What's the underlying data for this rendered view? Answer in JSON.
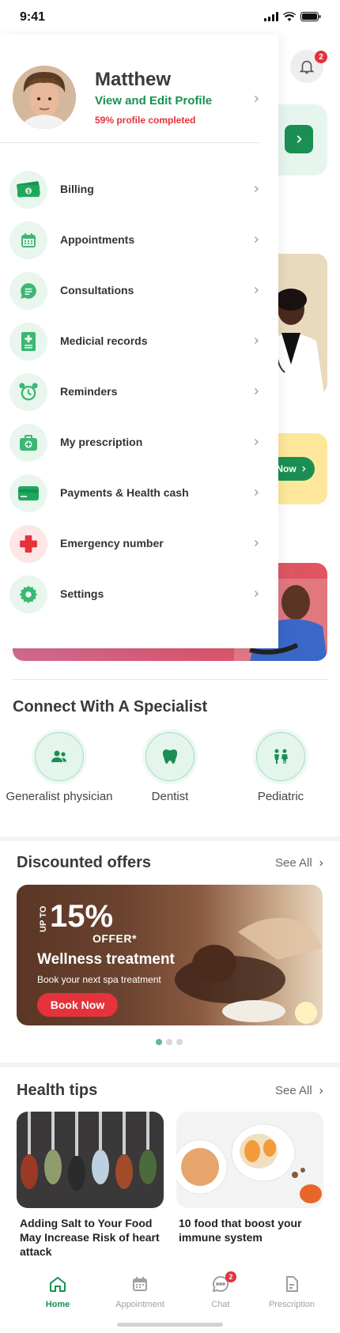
{
  "status_bar": {
    "time": "9:41"
  },
  "notifications": {
    "badge_count": "2"
  },
  "drawer": {
    "profile": {
      "name": "Matthew",
      "link_text": "View and Edit Profile",
      "completion_text": "59% profile completed"
    },
    "menu": [
      {
        "label": "Billing",
        "icon": "money-icon"
      },
      {
        "label": "Appointments",
        "icon": "calendar-icon"
      },
      {
        "label": "Consultations",
        "icon": "chat-icon"
      },
      {
        "label": "Medicial records",
        "icon": "medical-record-icon"
      },
      {
        "label": "Reminders",
        "icon": "alarm-clock-icon"
      },
      {
        "label": "My prescription",
        "icon": "medicine-kit-icon"
      },
      {
        "label": "Payments & Health cash",
        "icon": "credit-card-icon"
      },
      {
        "label": "Emergency number",
        "icon": "red-cross-icon"
      },
      {
        "label": "Settings",
        "icon": "gear-icon"
      }
    ]
  },
  "peek": {
    "now_button": "Now"
  },
  "specialists": {
    "title": "Connect With A Specialist",
    "items": [
      {
        "label": "Generalist physician",
        "icon": "users-icon"
      },
      {
        "label": "Dentist",
        "icon": "tooth-icon"
      },
      {
        "label": "Pediatric",
        "icon": "children-icon"
      }
    ]
  },
  "offers": {
    "title": "Discounted offers",
    "see_all": "See All",
    "banner": {
      "up_to": "UP TO",
      "percent": "15%",
      "offer_label": "OFFER*",
      "title": "Wellness treatment",
      "description": "Book your next spa treatment",
      "button": "Book Now"
    },
    "pages": 3,
    "active_page": 1
  },
  "health_tips": {
    "title": "Health tips",
    "see_all": "See All",
    "items": [
      {
        "title": "Adding Salt to Your Food May Increase Risk of heart attack"
      },
      {
        "title": "10 food that boost your immune system"
      }
    ]
  },
  "bottom_nav": {
    "items": [
      {
        "label": "Home",
        "icon": "home-icon",
        "active": true
      },
      {
        "label": "Appointment",
        "icon": "calendar-icon"
      },
      {
        "label": "Chat",
        "icon": "chat-bubble-icon",
        "badge": "2"
      },
      {
        "label": "Prescription",
        "icon": "document-icon"
      }
    ]
  },
  "colors": {
    "primary_green": "#1b8f53",
    "alert_red": "#e5323b",
    "icon_bg": "#e8f6ee"
  }
}
